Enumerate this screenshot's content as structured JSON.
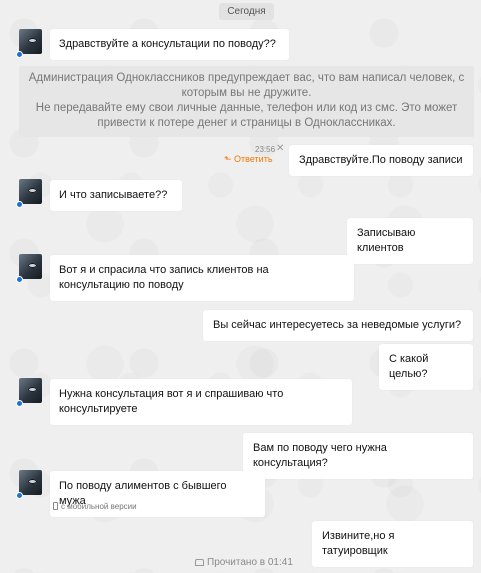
{
  "date_divider": "Сегодня",
  "warning": {
    "line1": "Администрация Одноклассников предупреждает вас, что вам написал человек, с которым вы не дружите.",
    "line2": "Не передавайте ему свои личные данные, телефон или код из смс. Это может привести к потере денег и страницы в Одноклассниках."
  },
  "messages": [
    {
      "dir": "in",
      "text": "Здравствуйте а консультации по поводу??"
    },
    {
      "dir": "out",
      "text": "Здравствуйте.По поводу записи",
      "time": "23:56",
      "reply_label": "Ответить",
      "close_glyph": "✕"
    },
    {
      "dir": "in",
      "text": "И что записываете??"
    },
    {
      "dir": "out",
      "text": "Записываю клиентов"
    },
    {
      "dir": "in",
      "line1": "Вот я и спрасила что запись клиентов на",
      "line2": "консультацию по поводу"
    },
    {
      "dir": "out",
      "text": "Вы сейчас интересуетесь за неведомые услуги?"
    },
    {
      "dir": "out",
      "text": "С какой целью?"
    },
    {
      "dir": "in",
      "line1": "Нужна консультация вот я и спрашиваю что",
      "line2": "консультируете"
    },
    {
      "dir": "out",
      "text": "Вам по поводу чего нужна консультация?"
    },
    {
      "dir": "in",
      "text": "По поводу алиментов с бывшего мужа",
      "meta": "с мобильной версии"
    },
    {
      "dir": "out",
      "text": "Извините,но я татуировщик"
    }
  ],
  "read_status": "Прочитано в 01:41",
  "icons": {
    "reply": "reply-arrow-icon",
    "mobile": "phone-icon",
    "read": "envelope-icon",
    "close": "close-icon"
  },
  "colors": {
    "online": "#1d73d1",
    "reply": "#f17900",
    "bubble": "#ffffff",
    "background": "#efefef"
  }
}
